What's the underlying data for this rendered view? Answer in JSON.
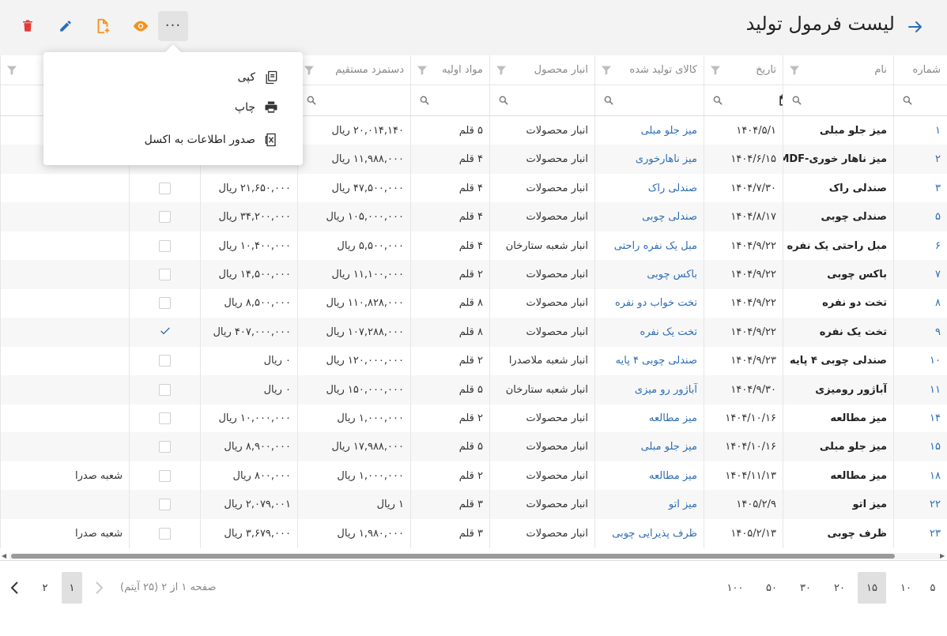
{
  "header": {
    "title": "لیست فرمول تولید",
    "back_icon": "arrow-right-icon",
    "actions": [
      {
        "name": "delete",
        "icon": "trash-icon",
        "color": "#e53935"
      },
      {
        "name": "edit",
        "icon": "pencil-icon",
        "color": "#2d6db5"
      },
      {
        "name": "add",
        "icon": "file-plus-icon",
        "color": "#f5921e"
      },
      {
        "name": "view",
        "icon": "eye-icon",
        "color": "#f5921e"
      },
      {
        "name": "more",
        "icon": "more-dots-icon",
        "label": "···"
      }
    ]
  },
  "menu": {
    "items": [
      {
        "label": "کپی",
        "icon": "copy-icon"
      },
      {
        "label": "چاپ",
        "icon": "printer-icon"
      },
      {
        "label": "صدور اطلاعات به اکسل",
        "icon": "excel-icon"
      }
    ]
  },
  "columns": [
    "شماره",
    "نام",
    "تاریخ",
    "کالای تولید شده",
    "انبار محصول",
    "مواد اولیه",
    "دستمزد مستقیم",
    "",
    "",
    ""
  ],
  "rows": [
    {
      "num": "۱",
      "name": "میز جلو مبلی",
      "date": "۱۴۰۴/۵/۱",
      "product": "میز جلو مبلی",
      "warehouse": "انبار محصولات",
      "materials": "۵ قلم",
      "wage": "۲۰,۰۱۴,۱۴۰ ریال",
      "cost": "",
      "checked": false,
      "branch": ""
    },
    {
      "num": "۲",
      "name": "میز ناهار خوری-MDF",
      "date": "۱۴۰۴/۶/۱۵",
      "product": "میز ناهارخوری",
      "warehouse": "انبار محصولات",
      "materials": "۴ قلم",
      "wage": "۱۱,۹۸۸,۰۰۰ ریال",
      "cost": "",
      "checked": false,
      "branch": ""
    },
    {
      "num": "۳",
      "name": "صندلی راک",
      "date": "۱۴۰۴/۷/۳۰",
      "product": "صندلی راک",
      "warehouse": "انبار محصولات",
      "materials": "۴ قلم",
      "wage": "۴۷,۵۰۰,۰۰۰ ریال",
      "cost": "۲۱,۶۵۰,۰۰۰ ریال",
      "checked": false,
      "branch": ""
    },
    {
      "num": "۵",
      "name": "صندلی چوبی",
      "date": "۱۴۰۴/۸/۱۷",
      "product": "صندلی چوبی",
      "warehouse": "انبار محصولات",
      "materials": "۴ قلم",
      "wage": "۱۰۵,۰۰۰,۰۰۰ ریال",
      "cost": "۳۴,۲۰۰,۰۰۰ ریال",
      "checked": false,
      "branch": ""
    },
    {
      "num": "۶",
      "name": "مبل راحتی یک نفره",
      "date": "۱۴۰۴/۹/۲۲",
      "product": "مبل یک نفره راحتی",
      "warehouse": "انبار شعبه ستارخان",
      "materials": "۴ قلم",
      "wage": "۵,۵۰۰,۰۰۰ ریال",
      "cost": "۱۰,۴۰۰,۰۰۰ ریال",
      "checked": false,
      "branch": ""
    },
    {
      "num": "۷",
      "name": "باکس چوبی",
      "date": "۱۴۰۴/۹/۲۲",
      "product": "باکس چوبی",
      "warehouse": "انبار محصولات",
      "materials": "۲ قلم",
      "wage": "۱۱,۱۰۰,۰۰۰ ریال",
      "cost": "۱۴,۵۰۰,۰۰۰ ریال",
      "checked": false,
      "branch": ""
    },
    {
      "num": "۸",
      "name": "تخت دو نفره",
      "date": "۱۴۰۴/۹/۲۲",
      "product": "تخت خواب دو نفره",
      "warehouse": "انبار محصولات",
      "materials": "۸ قلم",
      "wage": "۱۱۰,۸۲۸,۰۰۰ ریال",
      "cost": "۸,۵۰۰,۰۰۰ ریال",
      "checked": false,
      "branch": ""
    },
    {
      "num": "۹",
      "name": "تخت یک نفره",
      "date": "۱۴۰۴/۹/۲۲",
      "product": "تخت یک نفره",
      "warehouse": "انبار محصولات",
      "materials": "۸ قلم",
      "wage": "۱۰۷,۲۸۸,۰۰۰ ریال",
      "cost": "۴۰۷,۰۰۰,۰۰۰ ریال",
      "checked": true,
      "branch": ""
    },
    {
      "num": "۱۰",
      "name": "صندلی چوبی ۴ پایه",
      "date": "۱۴۰۴/۹/۲۳",
      "product": "صندلی چوبی ۴ پایه",
      "warehouse": "انبار شعبه ملاصدرا",
      "materials": "۲ قلم",
      "wage": "۱۲۰,۰۰۰,۰۰۰ ریال",
      "cost": "۰ ریال",
      "checked": false,
      "branch": ""
    },
    {
      "num": "۱۱",
      "name": "آباژور رومیزی",
      "date": "۱۴۰۴/۹/۳۰",
      "product": "آباژور رو میزی",
      "warehouse": "انبار شعبه ستارخان",
      "materials": "۵ قلم",
      "wage": "۱۵۰,۰۰۰,۰۰۰ ریال",
      "cost": "۰ ریال",
      "checked": false,
      "branch": ""
    },
    {
      "num": "۱۴",
      "name": "میز مطالعه",
      "date": "۱۴۰۴/۱۰/۱۶",
      "product": "میز مطالعه",
      "warehouse": "انبار محصولات",
      "materials": "۲ قلم",
      "wage": "۱,۰۰۰,۰۰۰ ریال",
      "cost": "۱۰,۰۰۰,۰۰۰ ریال",
      "checked": false,
      "branch": ""
    },
    {
      "num": "۱۵",
      "name": "میز جلو مبلی",
      "date": "۱۴۰۴/۱۰/۱۶",
      "product": "میز جلو مبلی",
      "warehouse": "انبار محصولات",
      "materials": "۵ قلم",
      "wage": "۱۷,۹۸۸,۰۰۰ ریال",
      "cost": "۸,۹۰۰,۰۰۰ ریال",
      "checked": false,
      "branch": ""
    },
    {
      "num": "۱۸",
      "name": "میز مطالعه",
      "date": "۱۴۰۴/۱۱/۱۳",
      "product": "میز مطالعه",
      "warehouse": "انبار محصولات",
      "materials": "۲ قلم",
      "wage": "۱,۰۰۰,۰۰۰ ریال",
      "cost": "۸۰۰,۰۰۰ ریال",
      "checked": false,
      "branch": "شعبه صدرا"
    },
    {
      "num": "۲۲",
      "name": "میز اتو",
      "date": "۱۴۰۵/۲/۹",
      "product": "میز اتو",
      "warehouse": "انبار محصولات",
      "materials": "۳ قلم",
      "wage": "۱ ریال",
      "cost": "۲,۰۷۹,۰۰۱ ریال",
      "checked": false,
      "branch": ""
    },
    {
      "num": "۲۳",
      "name": "ظرف چوبی",
      "date": "۱۴۰۵/۲/۱۳",
      "product": "ظرف پذیرایی چوبی",
      "warehouse": "انبار محصولات",
      "materials": "۳ قلم",
      "wage": "۱,۹۸۰,۰۰۰ ریال",
      "cost": "۳,۶۷۹,۰۰۰ ریال",
      "checked": false,
      "branch": "شعبه صدرا"
    }
  ],
  "pager": {
    "sizes": [
      "۵",
      "۱۰",
      "۱۵",
      "۲۰",
      "۳۰",
      "۵۰",
      "۱۰۰"
    ],
    "selected_size": "۱۵",
    "info": "صفحه ۱ از ۲ (۲۵ آیتم)",
    "pages": [
      "۱",
      "۲"
    ],
    "current_page": "۱"
  },
  "colors": {
    "accent": "#2d6db5",
    "delete": "#e53935",
    "orange": "#f5921e"
  }
}
